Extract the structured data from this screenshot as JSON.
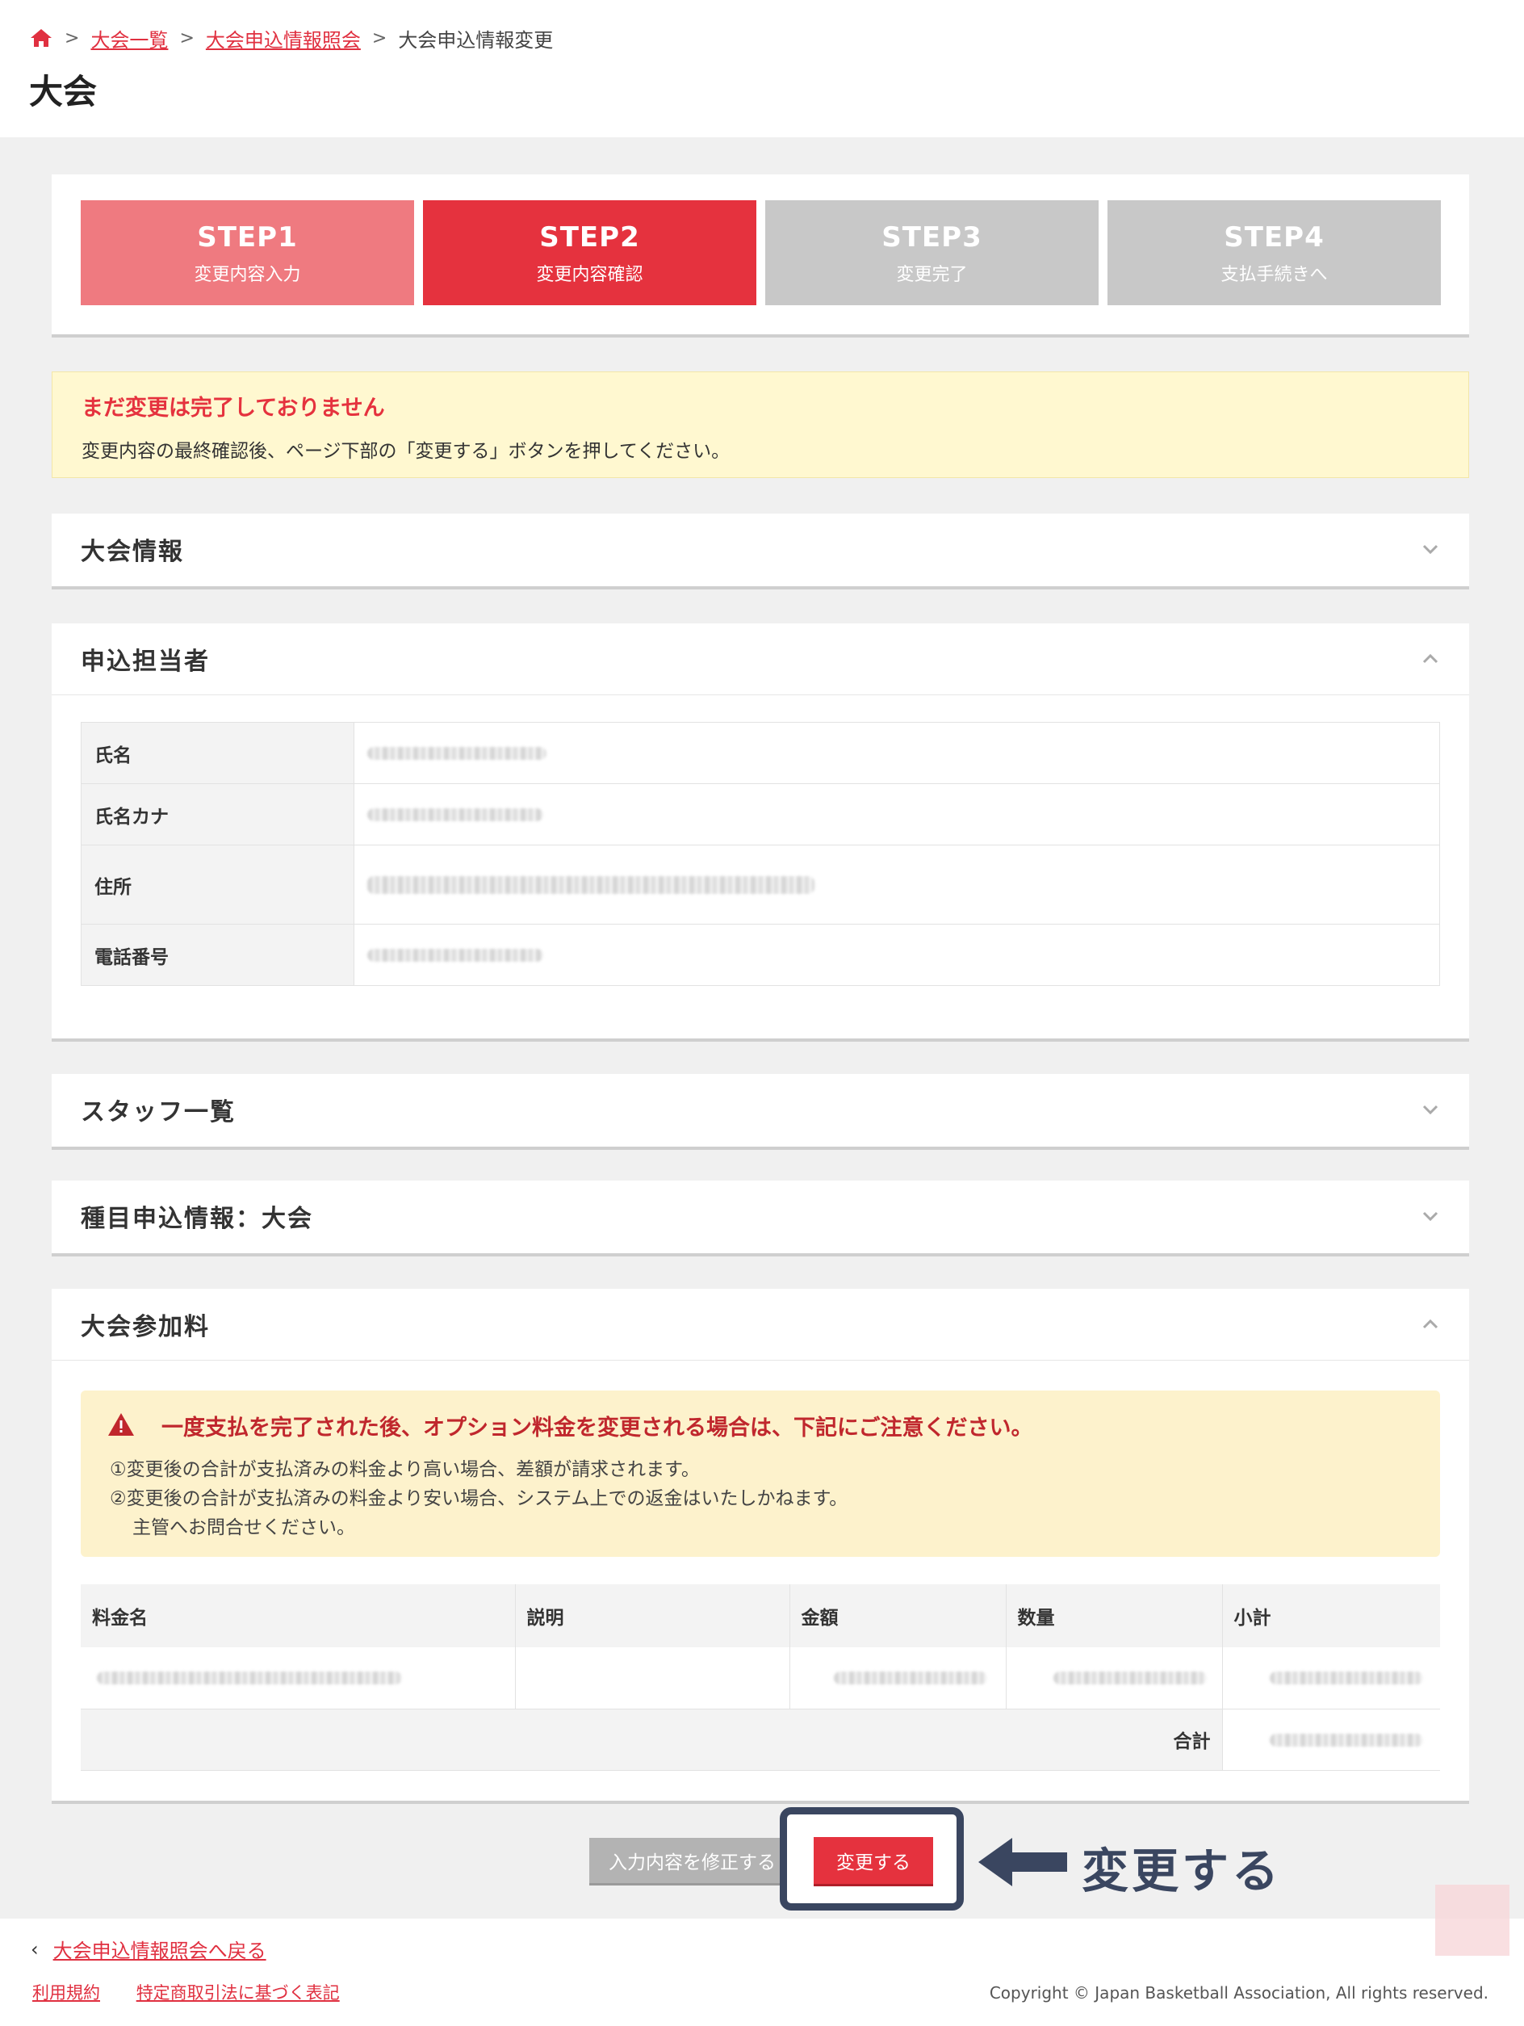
{
  "breadcrumb": {
    "items": [
      "大会一覧",
      "大会申込情報照会"
    ],
    "current": "大会申込情報変更"
  },
  "page_title": "大会",
  "steps": [
    {
      "num": "STEP1",
      "label": "変更内容入力",
      "state": "done"
    },
    {
      "num": "STEP2",
      "label": "変更内容確認",
      "state": "active"
    },
    {
      "num": "STEP3",
      "label": "変更完了",
      "state": "pending"
    },
    {
      "num": "STEP4",
      "label": "支払手続きへ",
      "state": "pending"
    }
  ],
  "notice": {
    "title": "まだ変更は完了しておりません",
    "text": "変更内容の最終確認後、ページ下部の「変更する」ボタンを押してください。"
  },
  "sections": {
    "tournament_info": "大会情報",
    "applicant": {
      "title": "申込担当者",
      "rows": [
        {
          "label": "氏名"
        },
        {
          "label": "氏名カナ"
        },
        {
          "label": "住所"
        },
        {
          "label": "電話番号"
        }
      ]
    },
    "staff": "スタッフ一覧",
    "event": "種目申込情報：大会",
    "fee": {
      "title": "大会参加料",
      "warning_title": "一度支払を完了された後、オプション料金を変更される場合は、下記にご注意ください。",
      "warning_lines": [
        "①変更後の合計が支払済みの料金より高い場合、差額が請求されます。",
        "②変更後の合計が支払済みの料金より安い場合、システム上での返金はいたしかねます。",
        "主管へお問合せください。"
      ],
      "columns": [
        "料金名",
        "説明",
        "金額",
        "数量",
        "小計"
      ],
      "total_label": "合計"
    }
  },
  "buttons": {
    "edit": "入力内容を修正する",
    "change": "変更する"
  },
  "callout": "変更する",
  "footer": {
    "back": "大会申込情報照会へ戻る",
    "links": [
      "利用規約",
      "特定商取引法に基づく表記"
    ],
    "copyright": "Copyright © Japan Basketball Association, All rights reserved."
  },
  "colors": {
    "accent": "#e5323e",
    "step_done": "#ef7a80",
    "step_pending": "#c8c8c8",
    "callout": "#3a4660",
    "notice_bg": "#fff8d0"
  }
}
